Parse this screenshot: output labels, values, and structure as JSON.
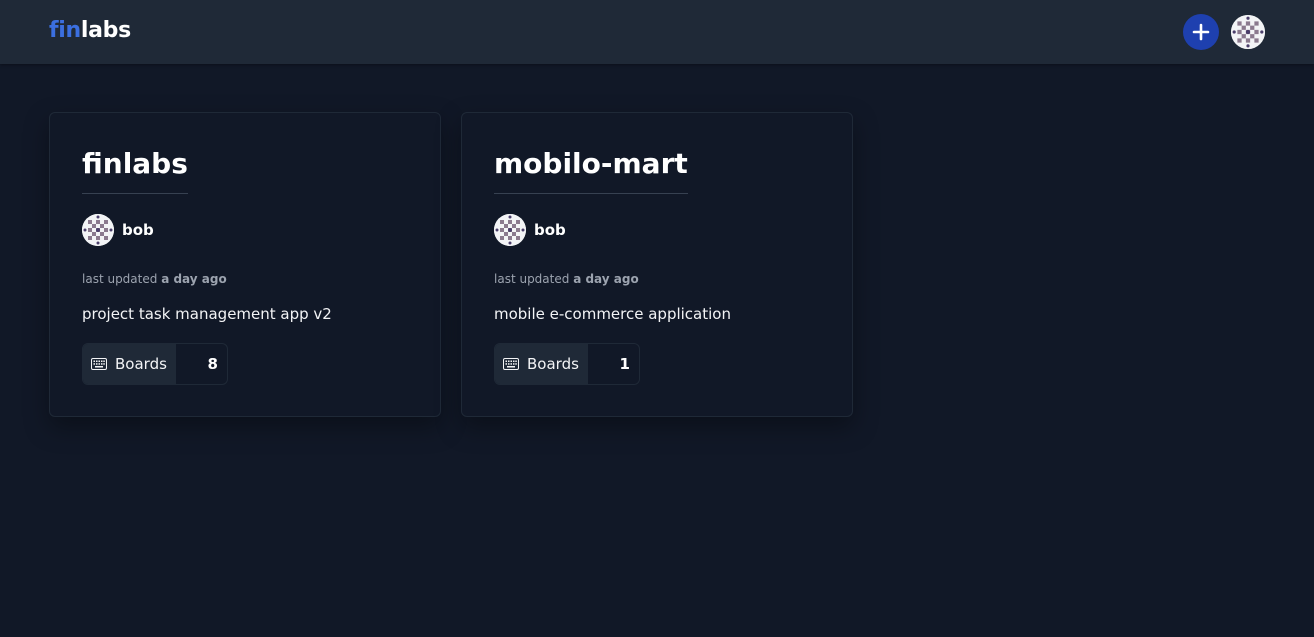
{
  "header": {
    "logo_part1": "fin",
    "logo_part2": "labs",
    "add_icon": "plus-icon",
    "avatar_icon": "user-avatar-icon"
  },
  "colors": {
    "background": "#111827",
    "topbar": "#1f2937",
    "accent": "#1e40af",
    "logo_blue": "#3b6fe0"
  },
  "projects": [
    {
      "title": "finlabs",
      "owner": "bob",
      "updated_prefix": "last updated",
      "updated_value": "a day ago",
      "description": "project task management app v2",
      "boards_label": "Boards",
      "boards_count": "8",
      "boards_icon": "keyboard-icon"
    },
    {
      "title": "mobilo-mart",
      "owner": "bob",
      "updated_prefix": "last updated",
      "updated_value": "a day ago",
      "description": "mobile e-commerce application",
      "boards_label": "Boards",
      "boards_count": "1",
      "boards_icon": "keyboard-icon"
    }
  ]
}
